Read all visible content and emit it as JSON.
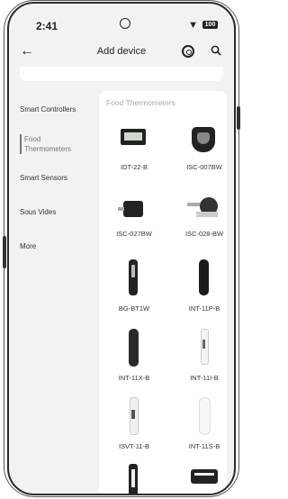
{
  "status": {
    "time": "2:41",
    "battery": "100"
  },
  "header": {
    "title": "Add device",
    "back_icon": "back-arrow-icon"
  },
  "sidebar": {
    "items": [
      {
        "label": "Smart Controllers"
      },
      {
        "label": "Food Thermometers",
        "active": true
      },
      {
        "label": "Smart Sensors"
      },
      {
        "label": "Sous Vides"
      },
      {
        "label": "More"
      }
    ]
  },
  "panel": {
    "title": "Food Thermometers",
    "devices": [
      {
        "label": "IDT-22-B"
      },
      {
        "label": "ISC-007BW"
      },
      {
        "label": "ISC-027BW"
      },
      {
        "label": "ISC-028-BW"
      },
      {
        "label": "BG-BT1W"
      },
      {
        "label": "INT-11P-B"
      },
      {
        "label": "INT-11X-B"
      },
      {
        "label": "INT-11I-B"
      },
      {
        "label": "ISVT-11-B"
      },
      {
        "label": "INT-11S-B"
      },
      {
        "label": ""
      },
      {
        "label": ""
      }
    ]
  }
}
